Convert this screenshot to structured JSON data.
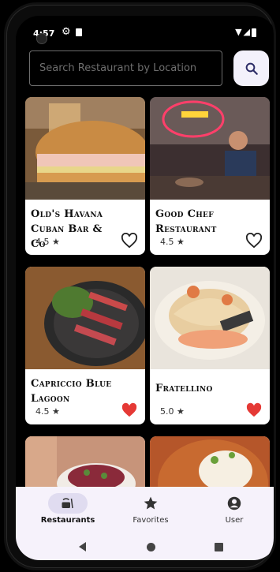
{
  "status_bar": {
    "time": "4:57"
  },
  "search": {
    "placeholder": "Search Restaurant by Location",
    "value": ""
  },
  "restaurants": [
    {
      "name": "Old's Havana Cuban Bar & Co",
      "rating": "4.5 ★",
      "favorite": false
    },
    {
      "name": "Good Chef Restaurant",
      "rating": "4.5 ★",
      "favorite": false
    },
    {
      "name": "Capriccio Blue Lagoon",
      "rating": "4.5 ★",
      "favorite": true
    },
    {
      "name": "Fratellino",
      "rating": "5.0 ★",
      "favorite": true
    }
  ],
  "bottom_nav": [
    {
      "label": "Restaurants",
      "icon": "restaurant-icon",
      "active": true
    },
    {
      "label": "Favorites",
      "icon": "star-icon",
      "active": false
    },
    {
      "label": "User",
      "icon": "user-icon",
      "active": false
    }
  ],
  "colors": {
    "heart_filled": "#e53935",
    "nav_bg": "#f6f2fb",
    "nav_active_pill": "#e0dcf0",
    "search_button_bg": "#f3f1fb"
  }
}
